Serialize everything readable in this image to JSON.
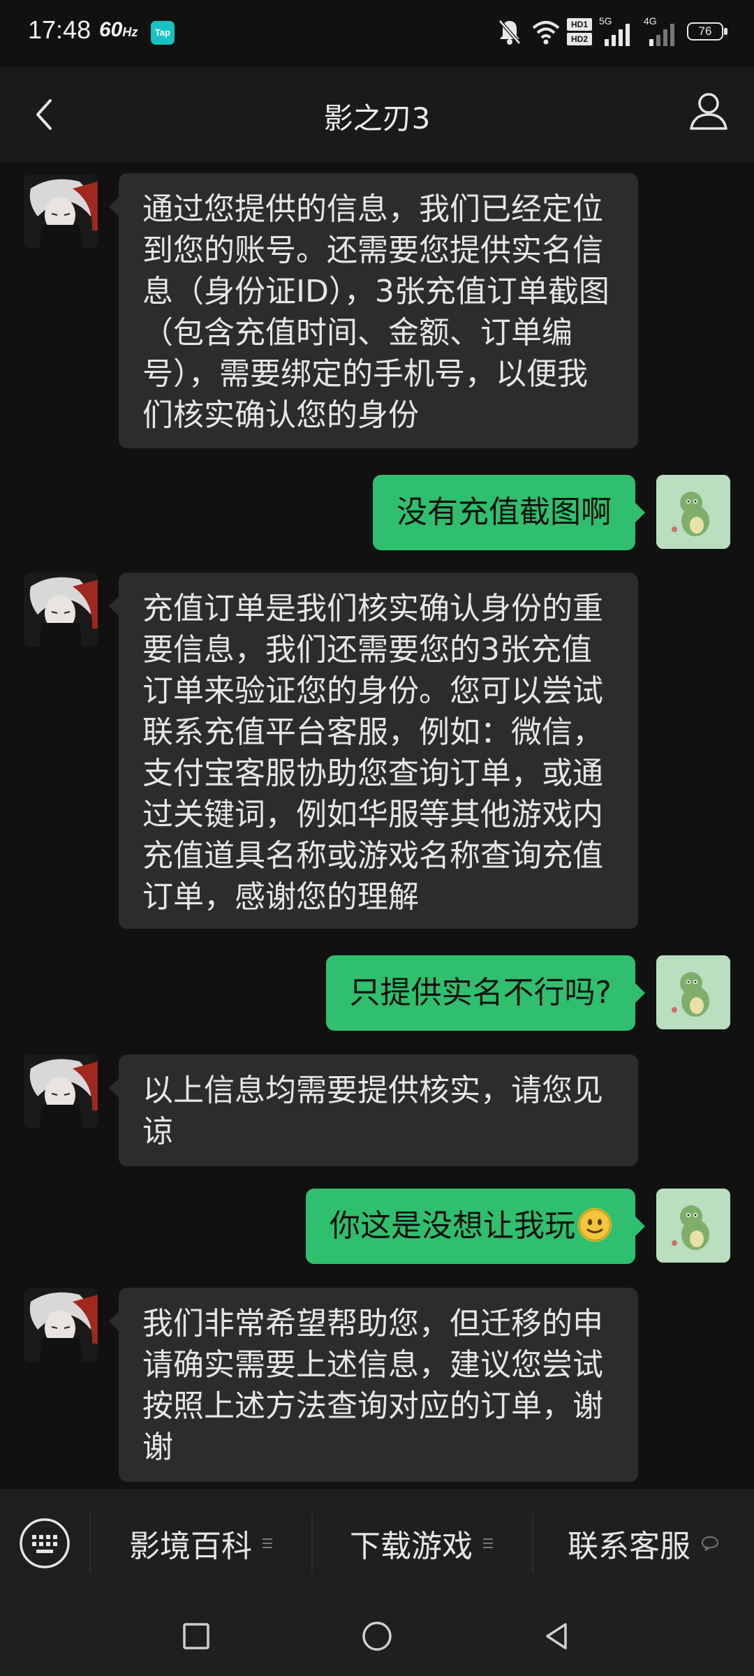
{
  "status_bar": {
    "time": "17:48",
    "refresh_rate": "60",
    "refresh_unit": "Hz",
    "tap_label": "Tap",
    "hd1": "HD1",
    "hd2": "HD2",
    "signal1_type": "5G",
    "signal2_type": "4G",
    "battery": "76"
  },
  "header": {
    "title": "影之刃3"
  },
  "messages": [
    {
      "from": "bot",
      "text": "通过您提供的信息，我们已经定位到您的账号。还需要您提供实名信息（身份证ID），3张充值订单截图（包含充值时间、金额、订单编号），需要绑定的手机号，以便我们核实确认您的身份"
    },
    {
      "from": "me",
      "text": "没有充值截图啊"
    },
    {
      "from": "bot",
      "text": "充值订单是我们核实确认身份的重要信息，我们还需要您的3张充值订单来验证您的身份。您可以尝试联系充值平台客服，例如：微信，支付宝客服协助您查询订单，或通过关键词，例如华服等其他游戏内充值道具名称或游戏名称查询充值订单，感谢您的理解"
    },
    {
      "from": "me",
      "text": "只提供实名不行吗?"
    },
    {
      "from": "bot",
      "text": "以上信息均需要提供核实，请您见谅"
    },
    {
      "from": "me",
      "text": "你这是没想让我玩"
    },
    {
      "from": "bot",
      "text": "我们非常希望帮助您，但迁移的申请确实需要上述信息，建议您尝试按照上述方法查询对应的订单，谢谢"
    }
  ],
  "bottom_menu": {
    "items": [
      {
        "label": "影境百科",
        "icon": "menu-lines-icon"
      },
      {
        "label": "下载游戏",
        "icon": "menu-lines-icon"
      },
      {
        "label": "联系客服",
        "icon": "chat-bubble-icon"
      }
    ]
  },
  "colors": {
    "background": "#111111",
    "bot_bubble": "#2c2c2c",
    "my_bubble": "#2fbf6e",
    "header": "#1a1a1a"
  }
}
